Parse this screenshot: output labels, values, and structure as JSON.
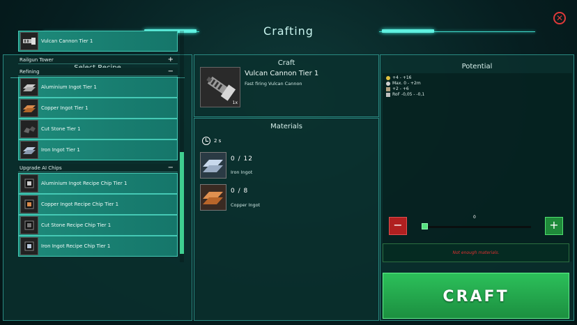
{
  "window": {
    "title": "Crafting",
    "close_label": "✕"
  },
  "left": {
    "title": "Select Recipe",
    "top_item": {
      "label": "Vulcan Cannon Tier 1",
      "icon": "vulcan-cannon-icon"
    },
    "categories": [
      {
        "name": "Railgun Tower",
        "sign": "+",
        "expanded": false
      },
      {
        "name": "Refining",
        "sign": "−",
        "expanded": true,
        "items": [
          {
            "label": "Aluminium Ingot Tier 1",
            "icon": "aluminium-ingot-icon"
          },
          {
            "label": "Copper Ingot Tier 1",
            "icon": "copper-ingot-icon"
          },
          {
            "label": "Cut Stone Tier 1",
            "icon": "cut-stone-icon"
          },
          {
            "label": "Iron Ingot Tier 1",
            "icon": "iron-ingot-icon"
          }
        ]
      },
      {
        "name": "Upgrade AI Chips",
        "sign": "−",
        "expanded": true,
        "items": [
          {
            "label": "Aluminium Ingot Recipe Chip Tier 1",
            "icon": "chip-icon"
          },
          {
            "label": "Copper Ingot Recipe Chip Tier 1",
            "icon": "chip-icon"
          },
          {
            "label": "Cut Stone Recipe Chip Tier 1",
            "icon": "chip-icon"
          },
          {
            "label": "Iron Ingot Recipe Chip Tier 1",
            "icon": "chip-icon"
          }
        ]
      }
    ]
  },
  "craft": {
    "title": "Craft",
    "item_name": "Vulcan Cannon Tier 1",
    "description": "Fast firing Vulcan Cannon",
    "quantity": "1x"
  },
  "materials": {
    "title": "Materials",
    "time": "2 s",
    "items": [
      {
        "count": "0 / 12",
        "name": "Iron Ingot",
        "color": "#9fb4cc"
      },
      {
        "count": "0 / 8",
        "name": "Copper Ingot",
        "color": "#c8773a"
      }
    ]
  },
  "potential": {
    "title": "Potential",
    "stats": [
      {
        "text": "+4 - +16",
        "color": "#e0c040"
      },
      {
        "text": "Max. 0 - +2m",
        "color": "#d0d0d0"
      },
      {
        "text": "+2 - +6",
        "color": "#b0a080"
      },
      {
        "text": "RoF -0,05 - -0,1",
        "color": "#c0c0c0"
      }
    ]
  },
  "controls": {
    "minus_label": "−",
    "plus_label": "+",
    "slider_value": "0",
    "warning": "Not enough materials.",
    "craft_label": "CRAFT"
  },
  "colors": {
    "accent": "#3fe0d0",
    "craft_green": "#2cc05a",
    "danger": "#e03030"
  }
}
